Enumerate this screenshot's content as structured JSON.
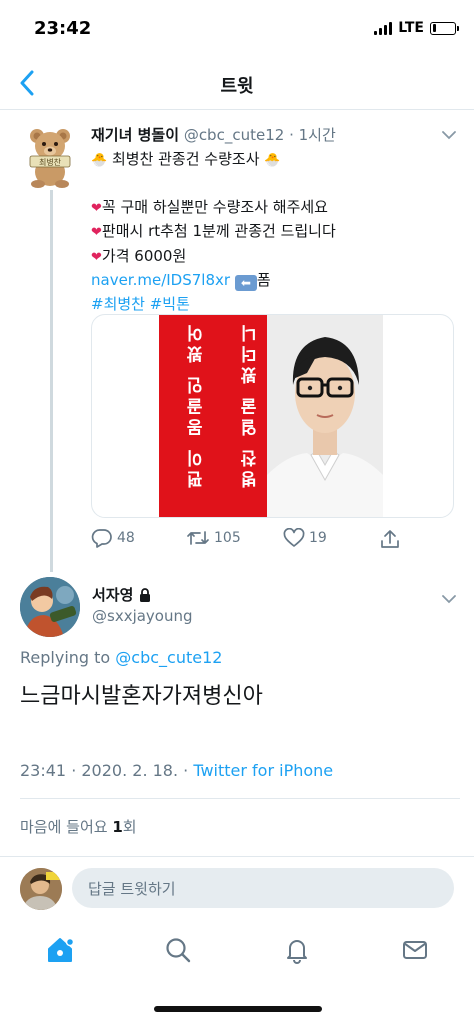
{
  "status_bar": {
    "time": "23:42",
    "network": "LTE",
    "battery_percent": 18
  },
  "header": {
    "title": "트윗",
    "back_icon": "chevron-left-icon"
  },
  "original_tweet": {
    "display_name": "재기녀 병돌이",
    "handle": "@cbc_cute12",
    "time_ago": "· 1시간",
    "avatar_badge": "최병찬",
    "title_line": "최병찬 관종건 수량조사",
    "lines": [
      "꼭 구매 하실뿐만 수량조사 해주세요",
      "판매시 rt추첨 1분께 관종건 드립니다",
      "가격 6000원"
    ],
    "link_text": "naver.me/IDS7l8xr",
    "link_suffix": "폼",
    "hashtags": "#최병찬 #빅톤",
    "image_text_columns": [
      "병찬 얼굴 봤더니",
      "편이 몽골인 봤어"
    ],
    "stats": {
      "replies": "48",
      "retweets": "105",
      "likes": "19"
    }
  },
  "reply_tweet": {
    "display_name": "서자영",
    "handle": "@sxxjayoung",
    "replying_prefix": "Replying to",
    "replying_to": "@cbc_cute12",
    "text": "느금마시발혼자가져병신아",
    "timestamp": "23:41 · 2020. 2. 18. ·",
    "source": "Twitter for iPhone",
    "likes_label_prefix": "마음에 들어요",
    "likes_count": "1",
    "likes_label_suffix": "회"
  },
  "composer": {
    "placeholder": "답글 트윗하기"
  },
  "colors": {
    "accent": "#1da1f2",
    "like_heart": "#e0245e",
    "image_red": "#e0121a",
    "muted": "#657786"
  },
  "tabs": [
    "home-icon",
    "search-icon",
    "notifications-icon",
    "messages-icon"
  ]
}
